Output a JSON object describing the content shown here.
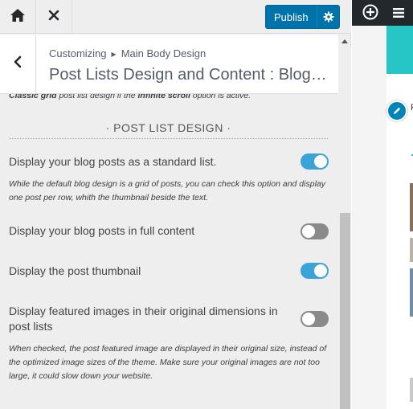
{
  "topbar": {
    "home_icon": "home-icon",
    "close_icon": "close-icon",
    "publish_label": "Publish",
    "publish_gear_icon": "gear-icon"
  },
  "section_header": {
    "breadcrumb_root": "Customizing",
    "breadcrumb_sep_icon": "triangle-right-icon",
    "breadcrumb_parent": "Main Body Design",
    "title": "Post Lists Design and Content : Blog, Ar..."
  },
  "content": {
    "intro_note": {
      "part1": "Classic grid",
      "part2": " post list design if the ",
      "part3": "infinite scroll",
      "part4": " option is active."
    },
    "section_heading": "· POST LIST DESIGN ·",
    "options": [
      {
        "label": "Display your blog posts as a standard list.",
        "checked": true,
        "note": "While the default blog design is a grid of posts, you can check this option and display one post per row, whith the thumbnail beside the text."
      },
      {
        "label": "Display your blog posts in full content",
        "checked": false,
        "note": ""
      },
      {
        "label": "Display the post thumbnail",
        "checked": true,
        "note": ""
      },
      {
        "label": "Display featured images in their original dimensions in post lists",
        "checked": false,
        "note": "When checked, the post featured image are displayed in their original size, instead of the optimized image sizes of the theme. Make sure your original images are not too large, it could slow down your website."
      }
    ]
  },
  "preview": {
    "add_icon": "plus-circle-icon",
    "menu_icon": "menu-icon",
    "edit_icon": "pencil-icon",
    "partial_text": "P",
    "accent_color": "#26c6c6"
  },
  "colors": {
    "publish_bg": "#0073aa",
    "toggle_on": "#3aa4d8",
    "toggle_off": "#8a8a8a",
    "panel_bg": "#eeeeee"
  }
}
